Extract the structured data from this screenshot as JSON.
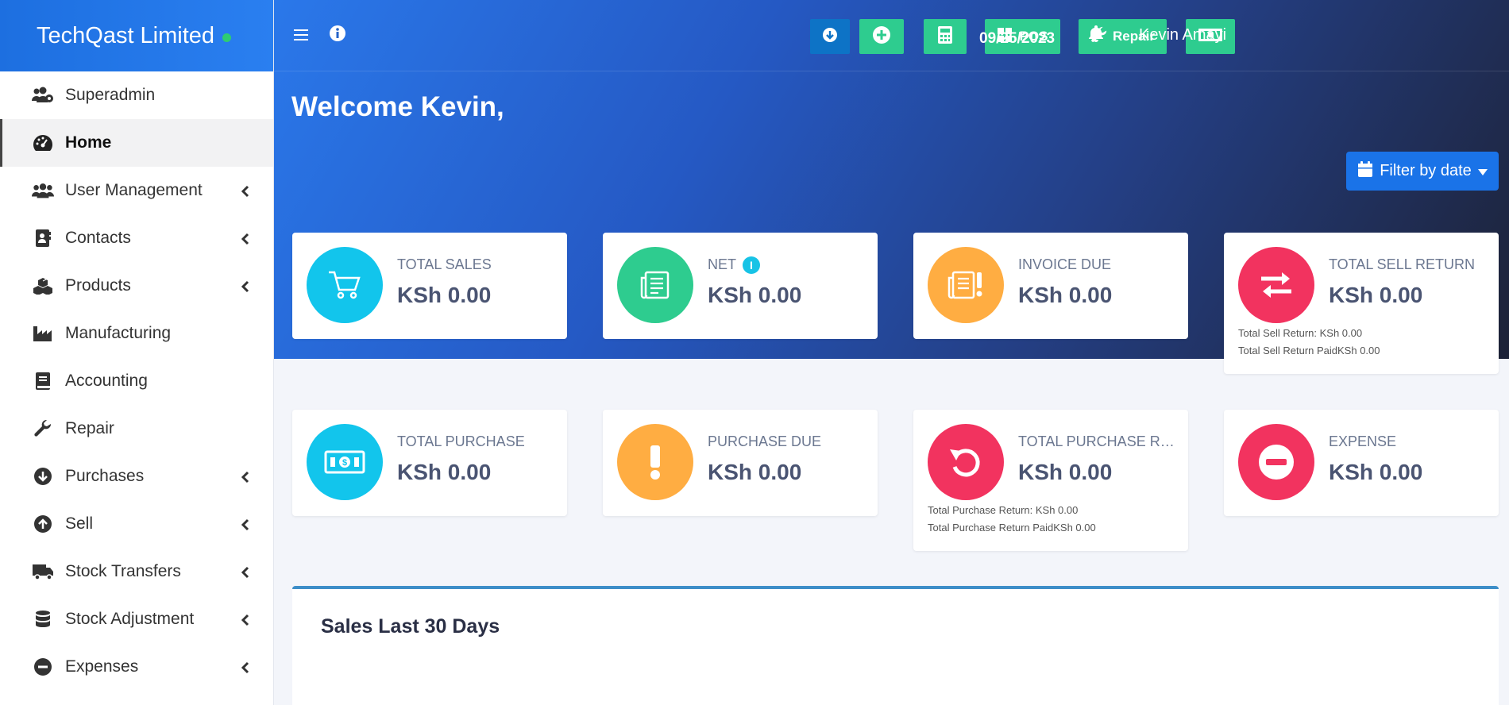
{
  "brand": {
    "name": "TechQast Limited"
  },
  "sidebar": {
    "items": [
      {
        "label": "Superadmin",
        "icon": "users-cog-icon",
        "has_submenu": false
      },
      {
        "label": "Home",
        "icon": "dashboard-icon",
        "has_submenu": false,
        "active": true
      },
      {
        "label": "User Management",
        "icon": "users-icon",
        "has_submenu": true
      },
      {
        "label": "Contacts",
        "icon": "address-book-icon",
        "has_submenu": true
      },
      {
        "label": "Products",
        "icon": "cubes-icon",
        "has_submenu": true
      },
      {
        "label": "Manufacturing",
        "icon": "industry-icon",
        "has_submenu": false
      },
      {
        "label": "Accounting",
        "icon": "book-icon",
        "has_submenu": false
      },
      {
        "label": "Repair",
        "icon": "wrench-icon",
        "has_submenu": false
      },
      {
        "label": "Purchases",
        "icon": "arrow-circle-down-icon",
        "has_submenu": true
      },
      {
        "label": "Sell",
        "icon": "arrow-circle-up-icon",
        "has_submenu": true
      },
      {
        "label": "Stock Transfers",
        "icon": "truck-icon",
        "has_submenu": true
      },
      {
        "label": "Stock Adjustment",
        "icon": "database-icon",
        "has_submenu": true
      },
      {
        "label": "Expenses",
        "icon": "minus-circle-icon",
        "has_submenu": true
      }
    ]
  },
  "header": {
    "pos_label": "POS",
    "repair_label": "Repair",
    "date": "09/25/2023",
    "user": "Kevin Amayi"
  },
  "main": {
    "welcome": "Welcome Kevin,",
    "filter_label": "Filter by date"
  },
  "cards": {
    "total_sales": {
      "label": "TOTAL SALES",
      "value": "KSh 0.00"
    },
    "net": {
      "label": "NET",
      "value": "KSh 0.00"
    },
    "invoice_due": {
      "label": "INVOICE DUE",
      "value": "KSh 0.00"
    },
    "total_sell_return": {
      "label": "TOTAL SELL RETURN",
      "value": "KSh 0.00",
      "sub1": "Total Sell Return: KSh 0.00",
      "sub2": "Total Sell Return PaidKSh 0.00"
    },
    "total_purchase": {
      "label": "TOTAL PURCHASE",
      "value": "KSh 0.00"
    },
    "purchase_due": {
      "label": "PURCHASE DUE",
      "value": "KSh 0.00"
    },
    "total_purchase_return": {
      "label": "TOTAL PURCHASE RETURN",
      "value": "KSh 0.00",
      "sub1": "Total Purchase Return: KSh 0.00",
      "sub2": "Total Purchase Return PaidKSh 0.00"
    },
    "expense": {
      "label": "EXPENSE",
      "value": "KSh 0.00"
    }
  },
  "sales_panel": {
    "title": "Sales Last 30 Days"
  },
  "colors": {
    "brand_blue": "#1d6fe0",
    "accent_green": "#2ecc8f",
    "cyan": "#12c5ec",
    "orange": "#ffad42",
    "red": "#f2335f"
  }
}
